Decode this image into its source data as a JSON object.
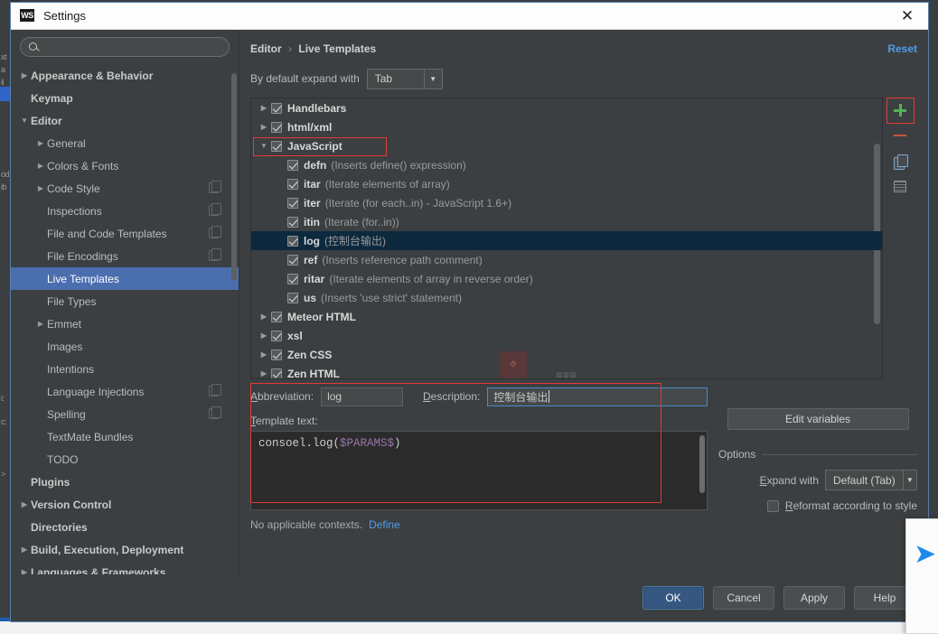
{
  "window": {
    "title": "Settings",
    "logo_text": "WS",
    "close_icon": "✕"
  },
  "search": {
    "placeholder": "",
    "value": "",
    "icon": "search-icon"
  },
  "sidebar": {
    "items": [
      {
        "label": "Appearance & Behavior",
        "tri": "▶",
        "indent": 0,
        "bold": true,
        "selected": false,
        "badge": false
      },
      {
        "label": "Keymap",
        "tri": "",
        "indent": 0,
        "bold": true,
        "selected": false,
        "badge": false
      },
      {
        "label": "Editor",
        "tri": "▼",
        "indent": 0,
        "bold": true,
        "selected": false,
        "badge": false
      },
      {
        "label": "General",
        "tri": "▶",
        "indent": 1,
        "bold": false,
        "selected": false,
        "badge": false
      },
      {
        "label": "Colors & Fonts",
        "tri": "▶",
        "indent": 1,
        "bold": false,
        "selected": false,
        "badge": false
      },
      {
        "label": "Code Style",
        "tri": "▶",
        "indent": 1,
        "bold": false,
        "selected": false,
        "badge": true
      },
      {
        "label": "Inspections",
        "tri": "",
        "indent": 1,
        "bold": false,
        "selected": false,
        "badge": true
      },
      {
        "label": "File and Code Templates",
        "tri": "",
        "indent": 1,
        "bold": false,
        "selected": false,
        "badge": true
      },
      {
        "label": "File Encodings",
        "tri": "",
        "indent": 1,
        "bold": false,
        "selected": false,
        "badge": true
      },
      {
        "label": "Live Templates",
        "tri": "",
        "indent": 1,
        "bold": false,
        "selected": true,
        "badge": false
      },
      {
        "label": "File Types",
        "tri": "",
        "indent": 1,
        "bold": false,
        "selected": false,
        "badge": false
      },
      {
        "label": "Emmet",
        "tri": "▶",
        "indent": 1,
        "bold": false,
        "selected": false,
        "badge": false
      },
      {
        "label": "Images",
        "tri": "",
        "indent": 1,
        "bold": false,
        "selected": false,
        "badge": false
      },
      {
        "label": "Intentions",
        "tri": "",
        "indent": 1,
        "bold": false,
        "selected": false,
        "badge": false
      },
      {
        "label": "Language Injections",
        "tri": "",
        "indent": 1,
        "bold": false,
        "selected": false,
        "badge": true
      },
      {
        "label": "Spelling",
        "tri": "",
        "indent": 1,
        "bold": false,
        "selected": false,
        "badge": true
      },
      {
        "label": "TextMate Bundles",
        "tri": "",
        "indent": 1,
        "bold": false,
        "selected": false,
        "badge": false
      },
      {
        "label": "TODO",
        "tri": "",
        "indent": 1,
        "bold": false,
        "selected": false,
        "badge": false
      },
      {
        "label": "Plugins",
        "tri": "",
        "indent": 0,
        "bold": true,
        "selected": false,
        "badge": false
      },
      {
        "label": "Version Control",
        "tri": "▶",
        "indent": 0,
        "bold": true,
        "selected": false,
        "badge": false
      },
      {
        "label": "Directories",
        "tri": "",
        "indent": 0,
        "bold": true,
        "selected": false,
        "badge": false
      },
      {
        "label": "Build, Execution, Deployment",
        "tri": "▶",
        "indent": 0,
        "bold": true,
        "selected": false,
        "badge": false
      },
      {
        "label": "Languages & Frameworks",
        "tri": "▶",
        "indent": 0,
        "bold": true,
        "selected": false,
        "badge": false
      }
    ]
  },
  "content": {
    "breadcrumb": {
      "parent": "Editor",
      "separator": "›",
      "current": "Live Templates"
    },
    "reset_label": "Reset",
    "expand_with": {
      "label": "By default expand with",
      "value": "Tab",
      "arrow": "▼"
    }
  },
  "templates": {
    "rows": [
      {
        "tri": "▶",
        "group": true,
        "name": "Handlebars",
        "desc": "",
        "selected": false,
        "highlight": false
      },
      {
        "tri": "▶",
        "group": true,
        "name": "html/xml",
        "desc": "",
        "selected": false,
        "highlight": false
      },
      {
        "tri": "▼",
        "group": true,
        "name": "JavaScript",
        "desc": "",
        "selected": false,
        "highlight": true
      },
      {
        "tri": "",
        "group": false,
        "name": "defn",
        "desc": "(Inserts define() expression)",
        "selected": false,
        "highlight": false
      },
      {
        "tri": "",
        "group": false,
        "name": "itar",
        "desc": "(Iterate elements of array)",
        "selected": false,
        "highlight": false
      },
      {
        "tri": "",
        "group": false,
        "name": "iter",
        "desc": "(Iterate (for each..in) - JavaScript 1.6+)",
        "selected": false,
        "highlight": false
      },
      {
        "tri": "",
        "group": false,
        "name": "itin",
        "desc": "(Iterate (for..in))",
        "selected": false,
        "highlight": false
      },
      {
        "tri": "",
        "group": false,
        "name": "log",
        "desc": "(控制台输出)",
        "selected": true,
        "highlight": false
      },
      {
        "tri": "",
        "group": false,
        "name": "ref",
        "desc": "(Inserts reference path comment)",
        "selected": false,
        "highlight": false
      },
      {
        "tri": "",
        "group": false,
        "name": "ritar",
        "desc": "(Iterate elements of array in reverse order)",
        "selected": false,
        "highlight": false
      },
      {
        "tri": "",
        "group": false,
        "name": "us",
        "desc": "(Inserts 'use strict' statement)",
        "selected": false,
        "highlight": false
      },
      {
        "tri": "▶",
        "group": true,
        "name": "Meteor HTML",
        "desc": "",
        "selected": false,
        "highlight": false
      },
      {
        "tri": "▶",
        "group": true,
        "name": "xsl",
        "desc": "",
        "selected": false,
        "highlight": false
      },
      {
        "tri": "▶",
        "group": true,
        "name": "Zen CSS",
        "desc": "",
        "selected": false,
        "highlight": false
      },
      {
        "tri": "▶",
        "group": true,
        "name": "Zen HTML",
        "desc": "",
        "selected": false,
        "highlight": false
      }
    ],
    "toolbar": {
      "add": "add-template-button",
      "remove": "remove-template-button",
      "duplicate": "duplicate-template-button",
      "group": "template-group-button"
    },
    "watermark_icon": "⌖"
  },
  "detail": {
    "abbreviation_label": "Abbreviation:",
    "abbreviation_value": "log",
    "description_label": "Description:",
    "description_value": "控制台输出",
    "template_text_label": "Template text:",
    "template_text_prefix": "consoel.log(",
    "template_text_var": "$PARAMS$",
    "template_text_suffix": ")",
    "context_text": "No applicable contexts.",
    "context_link": "Define",
    "edit_variables_label": "Edit variables",
    "options_title": "Options",
    "expand_with_label": "Expand with",
    "expand_with_value": "Default (Tab)",
    "expand_with_arrow": "▼",
    "reformat_label": "Reformat according to style"
  },
  "footer": {
    "ok": "OK",
    "cancel": "Cancel",
    "apply": "Apply",
    "help": "Help"
  },
  "background": {
    "edge_fragments": [
      "xt",
      "a",
      "il",
      "od",
      "ib",
      "i:",
      "c:",
      ">"
    ],
    "float_arrow_icon": "➤"
  },
  "colors": {
    "accent_blue": "#4b6eaf",
    "link_blue": "#4c9ee8",
    "selection_navy": "#0d293e",
    "highlight_red": "#e03a3a",
    "add_green": "#54b054",
    "remove_red": "#c9553b",
    "variable_purple": "#9876aa"
  }
}
